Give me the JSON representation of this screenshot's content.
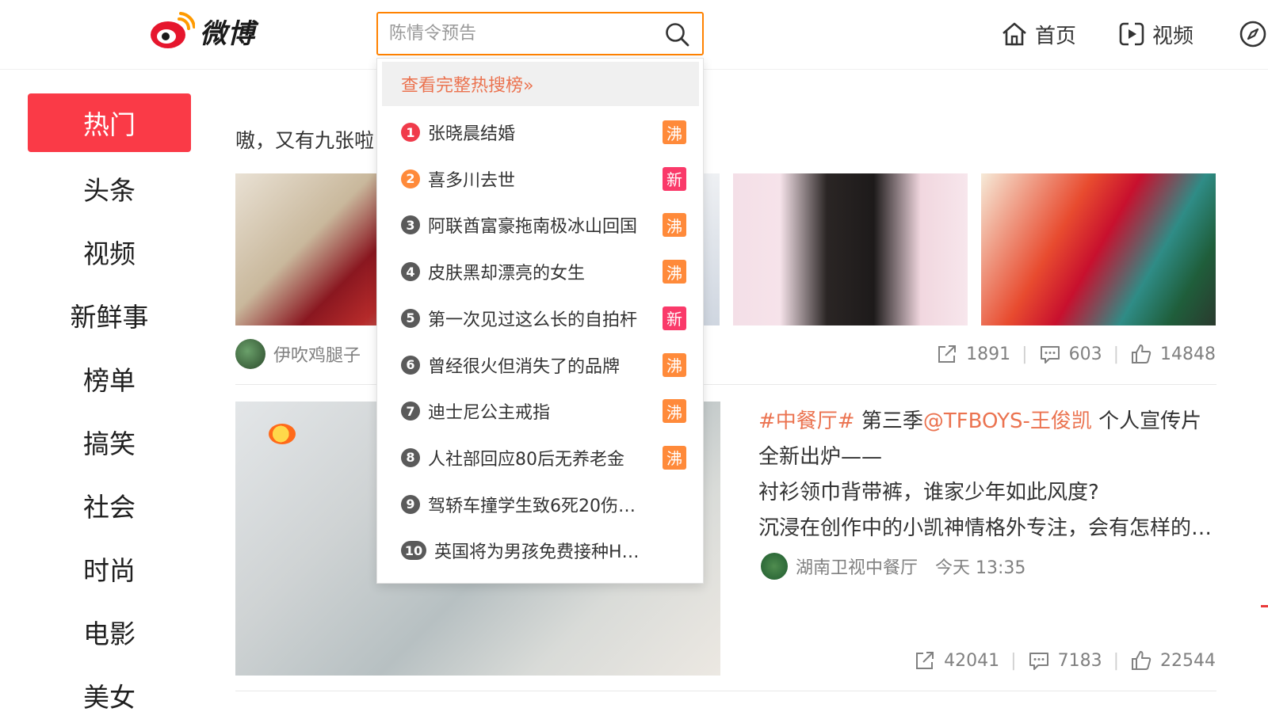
{
  "header": {
    "logo_text": "微博",
    "search_placeholder": "陈情令预告",
    "nav": [
      {
        "label": "首页",
        "icon": "home-icon"
      },
      {
        "label": "视频",
        "icon": "video-icon"
      },
      {
        "label": "",
        "icon": "compass-icon"
      }
    ]
  },
  "sidebar": {
    "items": [
      {
        "label": "热门",
        "active": true
      },
      {
        "label": "头条"
      },
      {
        "label": "视频"
      },
      {
        "label": "新鲜事"
      },
      {
        "label": "榜单"
      },
      {
        "label": "搞笑"
      },
      {
        "label": "社会"
      },
      {
        "label": "时尚"
      },
      {
        "label": "电影"
      },
      {
        "label": "美女"
      }
    ]
  },
  "feed": {
    "post1": {
      "text": "嗷，又有九张啦",
      "author": "伊吹鸡腿子",
      "shares": "1891",
      "comments": "603",
      "likes": "14848"
    },
    "post2": {
      "topic": "#中餐厅#",
      "text_a": " 第三季",
      "mention": "@TFBOYS-王俊凯",
      "text_b": " 个人宣传片",
      "line2": "全新出炉——",
      "line3": "衬衫领巾背带裤，谁家少年如此风度?",
      "line4": "沉浸在创作中的小凯神情格外专注，会有怎样的…",
      "author": "湖南卫视中餐厅",
      "time": "今天 13:35",
      "shares": "42041",
      "comments": "7183",
      "likes": "22544"
    }
  },
  "hot_search": {
    "header": "查看完整热搜榜»",
    "items": [
      {
        "rank": "1",
        "text": "张晓晨结婚",
        "tag": "沸",
        "rank_color": "#f03b4b",
        "tag_color": "#ff8a3a"
      },
      {
        "rank": "2",
        "text": "喜多川去世",
        "tag": "新",
        "rank_color": "#ff8a3a",
        "tag_color": "#fa3a6a"
      },
      {
        "rank": "3",
        "text": "阿联酋富豪拖南极冰山回国",
        "tag": "沸",
        "rank_color": "#5a5a5a",
        "tag_color": "#ff8a3a"
      },
      {
        "rank": "4",
        "text": "皮肤黑却漂亮的女生",
        "tag": "沸",
        "rank_color": "#5a5a5a",
        "tag_color": "#ff8a3a"
      },
      {
        "rank": "5",
        "text": "第一次见过这么长的自拍杆",
        "tag": "新",
        "rank_color": "#5a5a5a",
        "tag_color": "#fa3a6a"
      },
      {
        "rank": "6",
        "text": "曾经很火但消失了的品牌",
        "tag": "沸",
        "rank_color": "#5a5a5a",
        "tag_color": "#ff8a3a"
      },
      {
        "rank": "7",
        "text": "迪士尼公主戒指",
        "tag": "沸",
        "rank_color": "#5a5a5a",
        "tag_color": "#ff8a3a"
      },
      {
        "rank": "8",
        "text": "人社部回应80后无养老金",
        "tag": "沸",
        "rank_color": "#5a5a5a",
        "tag_color": "#ff8a3a"
      },
      {
        "rank": "9",
        "text": "驾轿车撞学生致6死20伤…",
        "tag": "",
        "rank_color": "#5a5a5a",
        "tag_color": ""
      },
      {
        "rank": "10",
        "text": "英国将为男孩免费接种H…",
        "tag": "",
        "rank_color": "#5a5a5a",
        "tag_color": ""
      }
    ]
  }
}
